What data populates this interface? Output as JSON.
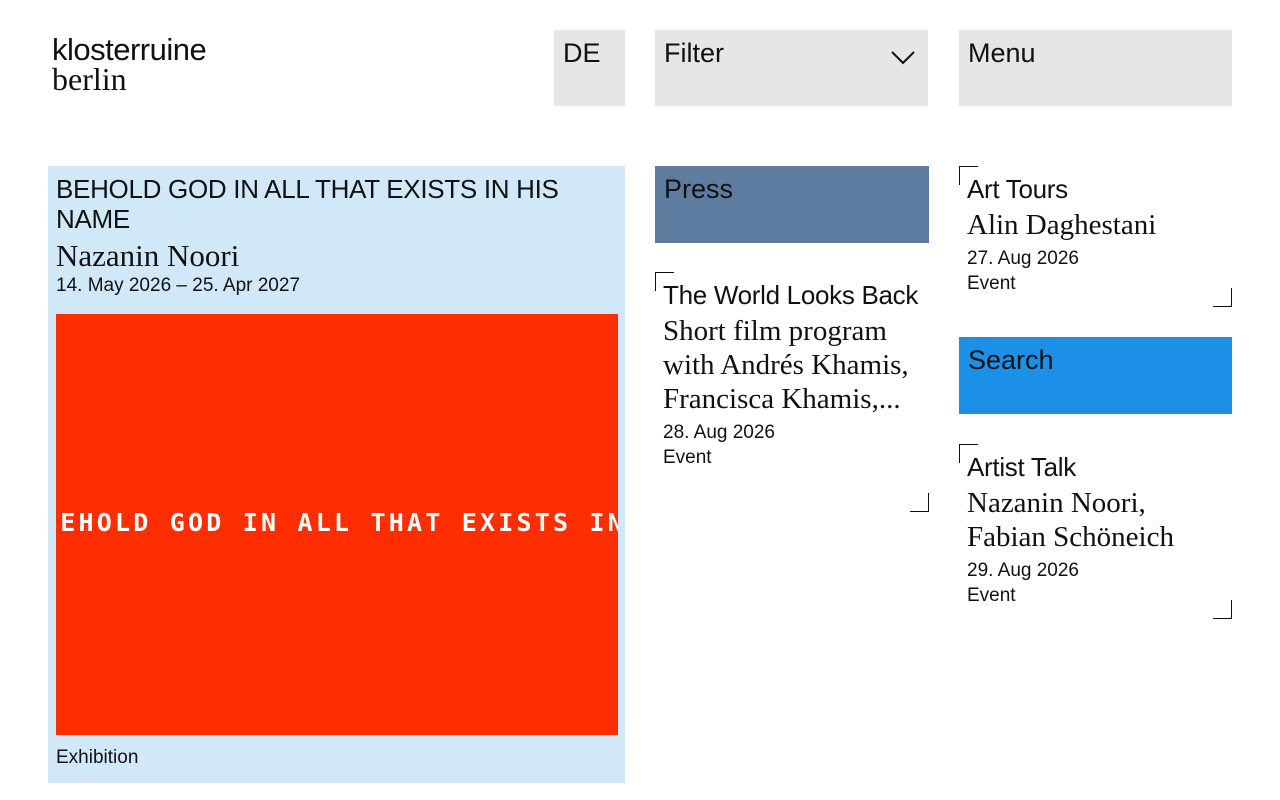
{
  "header": {
    "logo_line1": "klosterruine",
    "logo_line2": "berlin",
    "language_label": "DE",
    "filter_label": "Filter",
    "filter_icon": "chevron-down-icon",
    "menu_label": "Menu"
  },
  "featured": {
    "title": "BEHOLD GOD IN ALL THAT EXISTS IN HIS NAME",
    "artist": "Nazanin Noori",
    "date": "14. May 2026 – 25. Apr 2027",
    "poster_text": "BEHOLD GOD IN ALL THAT EXISTS IN HIS NAME",
    "type": "Exhibition",
    "background_color": "#d1e8f9",
    "poster_color": "#fe2e00"
  },
  "links": {
    "press_label": "Press",
    "press_color": "#5d7c9f",
    "search_label": "Search",
    "search_color": "#1c90e6"
  },
  "events": [
    {
      "title": "The World Looks Back",
      "subtitle": "Short film program with Andrés Khamis, Francisca Khamis,...",
      "date": "28. Aug 2026",
      "type": "Event"
    },
    {
      "title": "Art Tours",
      "subtitle": "Alin Daghestani",
      "date": "27. Aug 2026",
      "type": "Event"
    },
    {
      "title": "Artist Talk",
      "subtitle": "Nazanin Noori, Fabian Schöneich",
      "date": "29. Aug 2026",
      "type": "Event"
    }
  ]
}
